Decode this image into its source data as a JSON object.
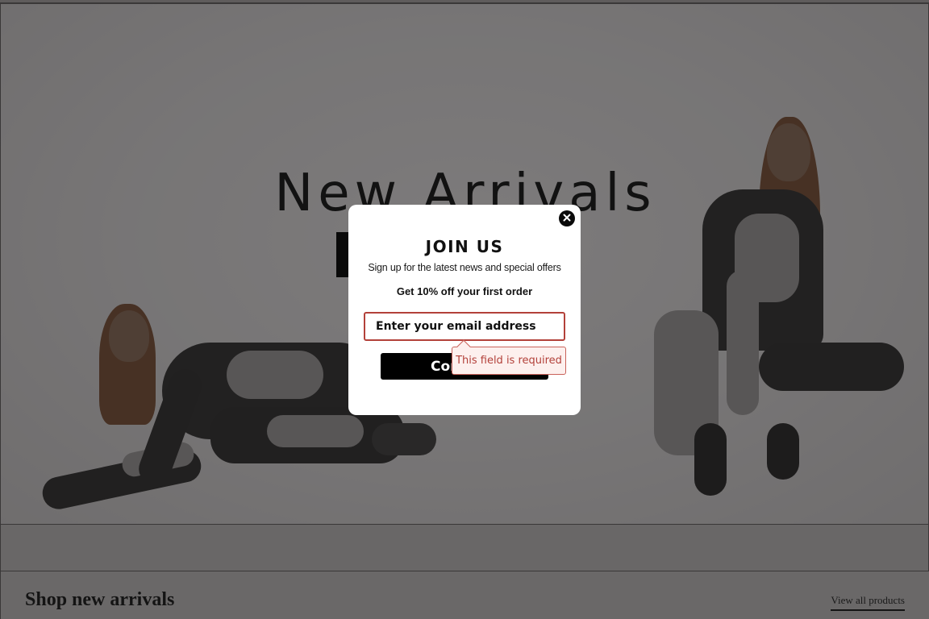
{
  "hero": {
    "title": "New Arrivals"
  },
  "popup": {
    "title": "JOIN US",
    "subtitle": "Sign up for the latest news and special offers",
    "offer": "Get 10% off your first order",
    "email_placeholder": "Enter your email address",
    "submit_label": "Continue",
    "error_message": "This field is required",
    "close_icon": "close-icon"
  },
  "shop_section": {
    "title": "Shop new arrivals",
    "view_all_label": "View all products"
  },
  "colors": {
    "overlay": "#6b6868",
    "error": "#b3413a",
    "button": "#000000",
    "modal_bg": "#ffffff"
  }
}
